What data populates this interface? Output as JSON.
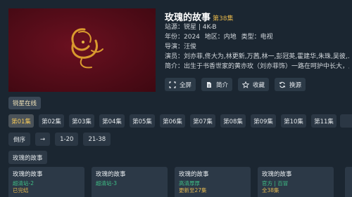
{
  "show": {
    "title": "玫瑰的故事",
    "current_episode": "第38集"
  },
  "info": {
    "source": "站源：锐星 | 4K-B",
    "year": "年份：2024",
    "region": "地区：内地",
    "type": "类型：电视",
    "director": "导演：汪俊",
    "cast": "演员：刘亦菲,佟大为,林更新,万茜,林一,彭冠英,霍建华,朱珠,吴彼,…",
    "summary": "简介：出生于书香世家的黄亦玫（刘亦菲饰）一路在呵护中长大，从"
  },
  "actions": {
    "fullscreen": "全屏",
    "intro": "简介",
    "favorite": "收藏",
    "switch_source": "换源"
  },
  "source_tag": "锐星在线",
  "episodes": [
    "第01集",
    "第02集",
    "第03集",
    "第04集",
    "第05集",
    "第06集",
    "第07集",
    "第08集",
    "第09集",
    "第10集",
    "第11集"
  ],
  "ranges": {
    "order": "倒序",
    "arrow": "→",
    "r1": "1-20",
    "r2": "21-38"
  },
  "related_tag": "玫瑰的故事",
  "related": [
    {
      "title": "玫瑰的故事",
      "source": "超清站-2",
      "status": "已完结"
    },
    {
      "title": "玫瑰的故事",
      "source": "超清站-3",
      "status": ""
    },
    {
      "title": "玫瑰的故事",
      "source": "高清厚厚",
      "status": "更新至27集"
    },
    {
      "title": "玫瑰的故事",
      "source": "官方 | 百冒",
      "status": "全38集"
    }
  ],
  "colors": {
    "background": "#1b2631",
    "accent_gold": "#e2b44a",
    "source_green": "#3fbf86",
    "player_red": "#5a0d1a"
  }
}
